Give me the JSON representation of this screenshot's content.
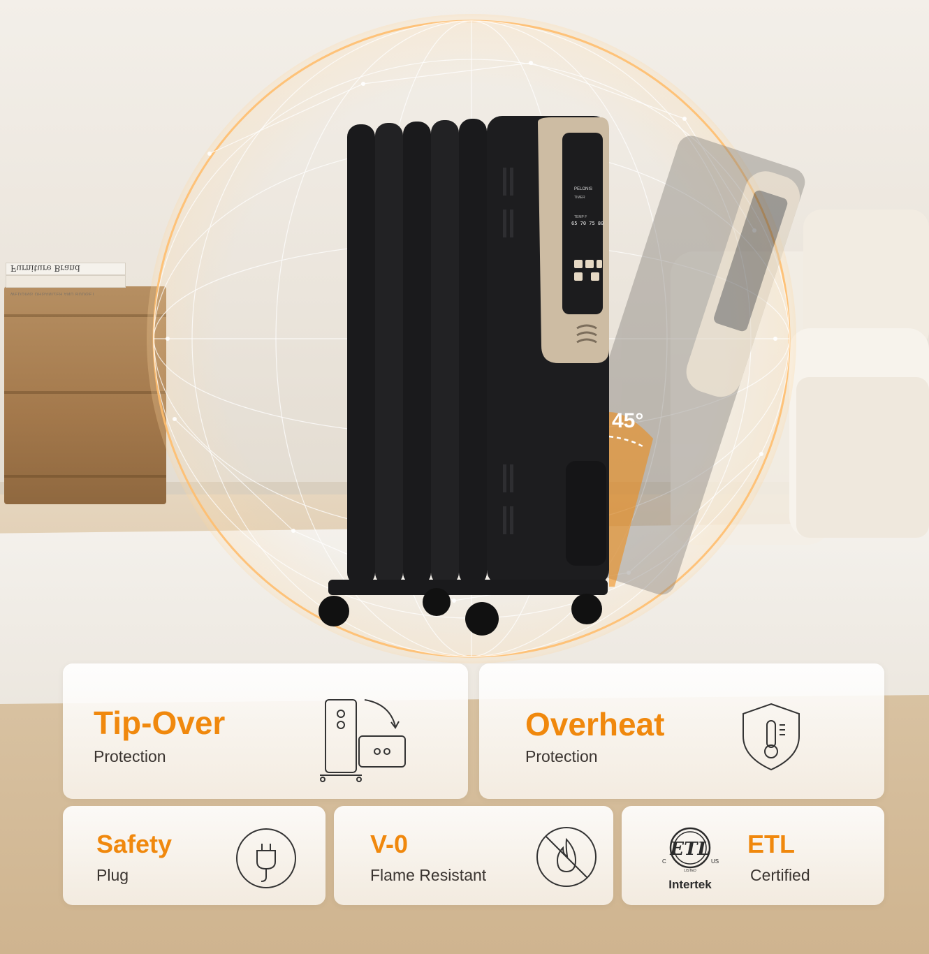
{
  "scene": {
    "book_title": "Furniture Brand",
    "book_subtitle": "WEDDING ORGANIZER AND BUDGET",
    "heater_brand": "PELONIS",
    "display_line1": "TIMER",
    "display_line2": "TEMP F",
    "display_readout": "65 70 75 80",
    "tilt_label": "45°"
  },
  "features": [
    {
      "title": "Tip-Over",
      "subtitle": "Protection",
      "icon": "tip-over-icon"
    },
    {
      "title": "Overheat",
      "subtitle": "Protection",
      "icon": "thermometer-shield-icon"
    },
    {
      "title": "Safety",
      "subtitle": "Plug",
      "icon": "plug-icon"
    },
    {
      "title": "V-0",
      "subtitle": "Flame Resistant",
      "icon": "flame-icon"
    },
    {
      "title": "ETL",
      "subtitle": "Certified",
      "icon": "etl-logo"
    }
  ],
  "etl_logo": {
    "c": "C",
    "us": "US",
    "listed": "LISTED",
    "brand": "Intertek"
  },
  "colors": {
    "accent": "#f0880d",
    "text": "#3a3430",
    "heater": "#1d1d1f",
    "panel": "#cdbca3"
  }
}
